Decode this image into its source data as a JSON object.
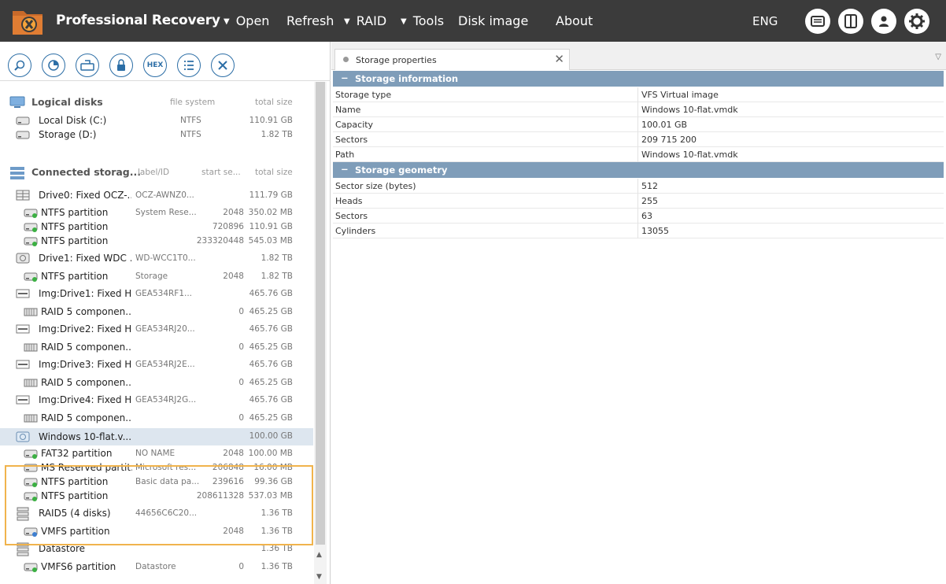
{
  "app": {
    "title": "Professional Recovery"
  },
  "menu": [
    {
      "label": "Open",
      "caret": true
    },
    {
      "label": "Refresh",
      "caret": false
    },
    {
      "label": "RAID",
      "caret": true
    },
    {
      "label": "Tools",
      "caret": true
    },
    {
      "label": "Disk image",
      "caret": false
    },
    {
      "label": "About",
      "caret": false
    }
  ],
  "lang": "ENG",
  "toolbar_hex": "HEX",
  "logical": {
    "title": "Logical disks",
    "col_fs": "file system",
    "col_total": "total size",
    "items": [
      {
        "name": "Local Disk (C:)",
        "fs": "NTFS",
        "total": "110.91 GB"
      },
      {
        "name": "Storage (D:)",
        "fs": "NTFS",
        "total": "1.82 TB"
      }
    ]
  },
  "connected": {
    "title": "Connected storag...",
    "col_label": "label/ID",
    "col_start": "start se...",
    "col_total": "total size",
    "items": [
      {
        "name": "Drive0: Fixed OCZ-...",
        "label": "OCZ-AWNZ0...",
        "start": "",
        "total": "111.79 GB",
        "level": 0,
        "icon": "drive"
      },
      {
        "name": "NTFS partition",
        "label": "System Rese...",
        "start": "2048",
        "total": "350.02 MB",
        "level": 1,
        "icon": "part"
      },
      {
        "name": "NTFS partition",
        "label": "",
        "start": "720896",
        "total": "110.91 GB",
        "level": 1,
        "icon": "part"
      },
      {
        "name": "NTFS partition",
        "label": "",
        "start": "233320448",
        "total": "545.03 MB",
        "level": 1,
        "icon": "part"
      },
      {
        "name": "Drive1: Fixed WDC ...",
        "label": "WD-WCC1T0...",
        "start": "",
        "total": "1.82 TB",
        "level": 0,
        "icon": "hdd"
      },
      {
        "name": "NTFS partition",
        "label": "Storage",
        "start": "2048",
        "total": "1.82 TB",
        "level": 1,
        "icon": "part"
      },
      {
        "name": "Img:Drive1: Fixed H...",
        "label": "GEA534RF1...",
        "start": "",
        "total": "465.76 GB",
        "level": 0,
        "icon": "img"
      },
      {
        "name": "RAID 5 componen...",
        "label": "",
        "start": "0",
        "total": "465.25 GB",
        "level": 1,
        "icon": "raid"
      },
      {
        "name": "Img:Drive2: Fixed H...",
        "label": "GEA534RJ20...",
        "start": "",
        "total": "465.76 GB",
        "level": 0,
        "icon": "img"
      },
      {
        "name": "RAID 5 componen...",
        "label": "",
        "start": "0",
        "total": "465.25 GB",
        "level": 1,
        "icon": "raid"
      },
      {
        "name": "Img:Drive3: Fixed H...",
        "label": "GEA534RJ2E...",
        "start": "",
        "total": "465.76 GB",
        "level": 0,
        "icon": "img"
      },
      {
        "name": "RAID 5 componen...",
        "label": "",
        "start": "0",
        "total": "465.25 GB",
        "level": 1,
        "icon": "raid"
      },
      {
        "name": "Img:Drive4: Fixed H...",
        "label": "GEA534RJ2G...",
        "start": "",
        "total": "465.76 GB",
        "level": 0,
        "icon": "img"
      },
      {
        "name": "RAID 5 componen...",
        "label": "",
        "start": "0",
        "total": "465.25 GB",
        "level": 1,
        "icon": "raid"
      },
      {
        "name": "Windows 10-flat.v...",
        "label": "",
        "start": "",
        "total": "100.00 GB",
        "level": 0,
        "icon": "vimg",
        "selected": true
      },
      {
        "name": "FAT32 partition",
        "label": "NO NAME",
        "start": "2048",
        "total": "100.00 MB",
        "level": 1,
        "icon": "part"
      },
      {
        "name": "MS Reserved partit...",
        "label": "Microsoft res...",
        "start": "206848",
        "total": "16.00 MB",
        "level": 1,
        "icon": "part-gray"
      },
      {
        "name": "NTFS partition",
        "label": "Basic data pa...",
        "start": "239616",
        "total": "99.36 GB",
        "level": 1,
        "icon": "part"
      },
      {
        "name": "NTFS partition",
        "label": "",
        "start": "208611328",
        "total": "537.03 MB",
        "level": 1,
        "icon": "part"
      },
      {
        "name": "RAID5 (4 disks)",
        "label": "44656C6C20...",
        "start": "",
        "total": "1.36 TB",
        "level": 0,
        "icon": "raidset"
      },
      {
        "name": "VMFS partition",
        "label": "",
        "start": "2048",
        "total": "1.36 TB",
        "level": 1,
        "icon": "part-vmfs"
      },
      {
        "name": "Datastore",
        "label": "",
        "start": "",
        "total": "1.36 TB",
        "level": 0,
        "icon": "raidset"
      },
      {
        "name": "VMFS6 partition",
        "label": "Datastore",
        "start": "0",
        "total": "1.36 TB",
        "level": 1,
        "icon": "part"
      }
    ]
  },
  "tab": {
    "label": "Storage properties"
  },
  "properties": [
    {
      "group": "Storage information",
      "rows": [
        {
          "key": "Storage type",
          "value": "VFS Virtual image"
        },
        {
          "key": "Name",
          "value": "Windows 10-flat.vmdk"
        },
        {
          "key": "Capacity",
          "value": "100.01 GB"
        },
        {
          "key": "Sectors",
          "value": "209 715 200"
        },
        {
          "key": "Path",
          "value": "Windows 10-flat.vmdk"
        }
      ]
    },
    {
      "group": "Storage geometry",
      "rows": [
        {
          "key": "Sector size (bytes)",
          "value": "512"
        },
        {
          "key": "Heads",
          "value": "255"
        },
        {
          "key": "Sectors",
          "value": "63"
        },
        {
          "key": "Cylinders",
          "value": "13055"
        }
      ]
    }
  ],
  "colors": {
    "header_bg": "#3b3b3b",
    "accent": "#2c6ea6",
    "group_bg": "#7f9db9",
    "highlight": "#f0b34c",
    "selected": "#dde6ef"
  }
}
